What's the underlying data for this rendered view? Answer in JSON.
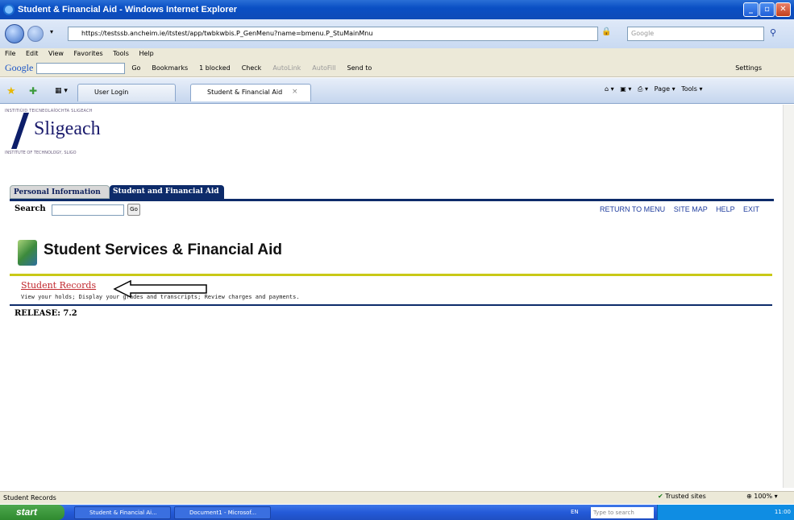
{
  "window": {
    "title": "Student & Financial Aid - Windows Internet Explorer"
  },
  "address": {
    "url": "https://testssb.ancheim.ie/itstest/app/twbkwbis.P_GenMenu?name=bmenu.P_StuMainMnu",
    "search_placeholder": "Google"
  },
  "menu": {
    "items": [
      "File",
      "Edit",
      "View",
      "Favorites",
      "Tools",
      "Help"
    ]
  },
  "google_toolbar": {
    "brand": "Google",
    "go": "Go",
    "bookmarks": "Bookmarks",
    "blocked": "1 blocked",
    "check": "Check",
    "autolink": "AutoLink",
    "autofill": "AutoFill",
    "sendto": "Send to",
    "settings": "Settings"
  },
  "browser_tabs": [
    {
      "label": "User Login"
    },
    {
      "label": "Student & Financial Aid"
    }
  ],
  "command_bar": {
    "page": "Page",
    "tools": "Tools"
  },
  "logo": {
    "top": "INSTITIÚID TEICNEOLAÍOCHTA SLIGEACH",
    "word": "Sligeach",
    "bottom": "INSTITUTE OF TECHNOLOGY, SLIGO"
  },
  "page_tabs": [
    {
      "label": "Personal Information"
    },
    {
      "label": "Student and Financial Aid"
    }
  ],
  "search": {
    "label": "Search",
    "go": "Go"
  },
  "top_links": [
    "RETURN TO MENU",
    "SITE MAP",
    "HELP",
    "EXIT"
  ],
  "page": {
    "title": "Student Services & Financial Aid",
    "link": "Student Records",
    "description": "View your holds; Display your grades and transcripts; Review charges and payments.",
    "release": "RELEASE: 7.2"
  },
  "statusbar": {
    "text": "Student Records",
    "zone": "Trusted sites",
    "zoom": "100%"
  },
  "taskbar": {
    "start": "start",
    "tasks": [
      "Student & Financial Ai...",
      "Document1 - Microsof..."
    ],
    "lang": "EN",
    "search_placeholder": "Type to search",
    "clock": "11:00"
  }
}
